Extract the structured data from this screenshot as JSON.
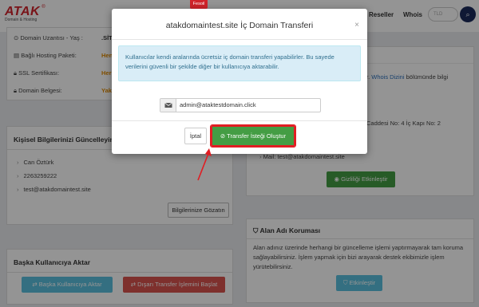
{
  "header": {
    "logo_text": "ATAK",
    "logo_subtext": "Domain & Hosting",
    "nav": [
      "Reseller",
      "Whois"
    ],
    "search_placeholder": "TLD",
    "promo_tag": "Fesoil"
  },
  "domain_info": {
    "rows": [
      {
        "label": "Domain Uzantısı - Yaş :",
        "value": ".SİT",
        "color": "#333333"
      },
      {
        "label": "Bağlı Hosting Paketi:",
        "value": "Hen",
        "color": "#e08a00"
      },
      {
        "label": "SSL Sertifikası:",
        "value": "Her",
        "color": "#e08a00"
      },
      {
        "label": "Domain Belgesi:",
        "value": "Yak",
        "color": "#e08a00"
      }
    ]
  },
  "personal_info": {
    "title": "Kişisel Bilgilerinizi Güncelleyin",
    "items": [
      "Can Öztürk",
      "2263259222",
      "test@atakdomaintest.site"
    ],
    "view_button": "Bilgilerinize Gözatın"
  },
  "transfer_user": {
    "title": "Başka Kullanıcıya Aktar",
    "transfer_button": "Başka Kullanıcıya Aktar",
    "external_button": "Dışarı Transfer İşlemini Başlat"
  },
  "right_panel": {
    "text_fragment_1": "r.",
    "whois_link": "Whois Dizini",
    "text_fragment_2": "bölümünde bilgi",
    "address_fragment": "Caddesi No: 4 İç Kapı No: 2",
    "mail_line": "Mail: test@atakdomaintest.site",
    "privacy_button": "Gizliliği Etkinleştir"
  },
  "domain_protection": {
    "title": "Alan Adı Koruması",
    "description": "Alan adınız üzerinde herhangi bir güncelleme işlemi yaptırmayarak tam koruma sağlayabilirsiniz. İşlem yapmak için bizi arayarak destek ekibimizle işlem yürütebilirsiniz.",
    "enable_button": "Etkinleştir"
  },
  "modal": {
    "title": "atakdomaintest.site İç Domain Transferi",
    "alert": "Kullanıcılar kendi aralarında ücretsiz iç domain transferi yapabilirler. Bu sayede verilerini güvenli bir şekilde diğer bir kullanıcıya aktarabilir.",
    "email_value": "admin@ataktestdomain.click",
    "cancel_label": "İptal",
    "submit_label": "Transfer İsteği Oluştur"
  },
  "colors": {
    "brand_red": "#d0242b",
    "success_green": "#449d44",
    "info_blue": "#5bc0de",
    "danger_red": "#d9534f",
    "highlight_red": "#e11d23"
  }
}
